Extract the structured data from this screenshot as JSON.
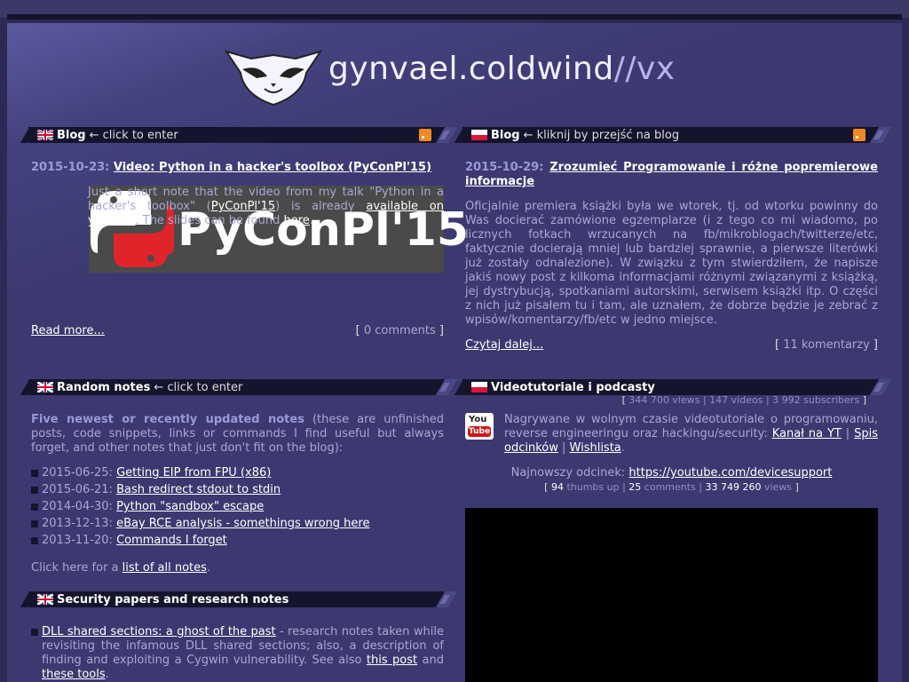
{
  "site": {
    "name": "gynvael.coldwind",
    "suffix": "//vx"
  },
  "blog_en": {
    "title": "Blog",
    "subtitle": "← click to enter",
    "post_date": "2015-10-23:",
    "post_title": "Video: Python in a hacker's toolbox (PyConPl'15)",
    "image_text": "PyConPl'15",
    "body_pre": "Just a short note that the video from my talk \"Python in a hacker's toolbox\" (",
    "body_link1": "PyConPl'15",
    "body_mid1": ") is already ",
    "body_link2": "available on youtube",
    "body_mid2": ". The slides can be found ",
    "body_link3": "here",
    "body_end": ".",
    "read_more": "Read more...",
    "comments": "0 comments"
  },
  "blog_pl": {
    "title": "Blog",
    "subtitle": "← kliknij by przejść na blog",
    "post_date": "2015-10-29:",
    "post_title": "Zrozumieć Programowanie i różne popremierowe informacje",
    "body": "Oficjalnie premiera książki była we wtorek, tj. od wtorku powinny do Was docierać zamówione egzemplarze (i z tego co mi wiadomo, po licznych fotkach wrzucanych na fb/mikroblogach/twitterze/etc, faktycznie docierają mniej lub bardziej sprawnie, a pierwsze literówki już zostały odnalezione). W związku z tym stwierdziłem, że napisze jakiś nowy post z kilkoma informacjami różnymi związanymi z książką, jej dystrybucją, spotkaniami autorskimi, serwisem książki itp. O części z nich już pisałem tu i tam, ale uznałem, że dobrze będzie je zebrać z wpisów/komentarzy/fb/etc w jedno miejsce.",
    "read_more": "Czytaj dalej...",
    "comments": "11 komentarzy"
  },
  "random_notes": {
    "title": "Random notes",
    "subtitle": "← click to enter",
    "intro_bold": "Five newest or recently updated notes",
    "intro_rest": " (these are unfinished posts, code snippets, links or commands I find useful but always forget, and other notes that just don't fit on the blog):",
    "items": [
      {
        "date": "2015-06-25:",
        "label": "Getting EIP from FPU (x86)"
      },
      {
        "date": "2015-06-21:",
        "label": "Bash redirect stdout to stdin"
      },
      {
        "date": "2014-04-30:",
        "label": "Python \"sandbox\" escape"
      },
      {
        "date": "2013-12-13:",
        "label": "eBay RCE analysis - somethings wrong here"
      },
      {
        "date": "2013-11-20:",
        "label": "Commands I forget"
      }
    ],
    "footer_pre": "Click here for a ",
    "footer_link": "list of all notes",
    "footer_end": "."
  },
  "security": {
    "title": "Security papers and research notes",
    "item_link": "DLL shared sections: a ghost of the past",
    "item_text": " - research notes taken while revisiting the infamous DLL shared sections; also, a description of finding and exploiting a Cygwin vulnerability. See also ",
    "item_link2": "this post",
    "item_and": " and ",
    "item_link3": "these tools",
    "item_end": "."
  },
  "video": {
    "title": "Videotutoriale i podcasty",
    "stats": {
      "views": "344 700 views",
      "videos": "147 videos",
      "subscribers": "3 992 subscribers"
    },
    "yt_you": "You",
    "yt_tube": "Tube",
    "desc": "Nagrywane w wolnym czasie videotutoriale o programowaniu, reverse engineeringu oraz hackingu/security: ",
    "link_channel": "Kanał na YT",
    "sep": " | ",
    "link_list": "Spis odcinków",
    "link_wish": "Wishlista",
    "desc_end": ".",
    "newest_label": "Najnowszy odcinek: ",
    "newest_link": "https://youtube.com/devicesupport",
    "thumbs_num": "94",
    "thumbs_label": " thumbs up",
    "comments_num": "25",
    "comments_label": " comments",
    "views_num": "33 749 260",
    "views_label": " views"
  }
}
